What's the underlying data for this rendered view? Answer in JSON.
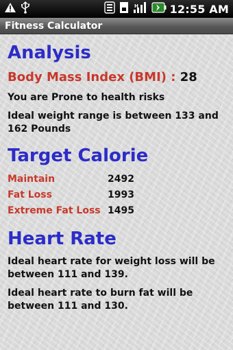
{
  "status_bar": {
    "time": "12:55 AM",
    "icons": [
      "warning-icon",
      "usb-icon",
      "wifi-icon",
      "sd-card-icon",
      "signal-icon",
      "battery-icon"
    ]
  },
  "app": {
    "title": "Fitness Calculator"
  },
  "analysis": {
    "heading": "Analysis",
    "bmi_label": "Body Mass Index (BMI) :",
    "bmi_value": "28",
    "risk_text": "You are Prone to health risks",
    "weight_range_text": "Ideal weight range is between 133 and 162 Pounds"
  },
  "target_calorie": {
    "heading": "Target Calorie",
    "rows": [
      {
        "label": "Maintain",
        "value": "2492"
      },
      {
        "label": "Fat Loss",
        "value": "1993"
      },
      {
        "label": "Extreme Fat Loss",
        "value": "1495"
      }
    ]
  },
  "heart_rate": {
    "heading": "Heart Rate",
    "weight_loss_text": "Ideal heart rate for weight loss will be between 111 and 139.",
    "burn_fat_text": "Ideal heart rate to burn fat will be between 111 and 130."
  },
  "colors": {
    "heading_blue": "#2c2cc8",
    "label_red": "#c8382c",
    "status_bar": "#000000",
    "title_bar": "#555555"
  }
}
